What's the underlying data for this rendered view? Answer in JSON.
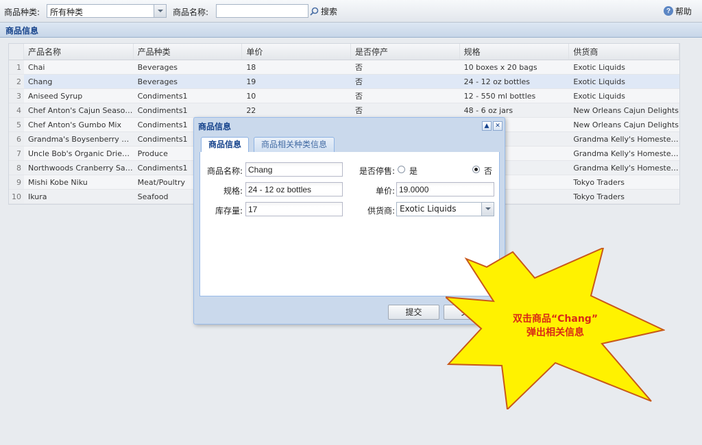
{
  "toolbar": {
    "category_label": "商品种类:",
    "category_value": "所有种类",
    "name_label": "商品名称:",
    "name_value": "",
    "search_label": "搜索",
    "help_label": "帮助"
  },
  "panel": {
    "title": "商品信息"
  },
  "grid": {
    "columns": [
      "产品名称",
      "产品种类",
      "单价",
      "是否停产",
      "规格",
      "供货商"
    ],
    "rows": [
      {
        "num": "1",
        "name": "Chai",
        "cat": "Beverages",
        "price": "18",
        "disc": "否",
        "spec": "10 boxes x 20 bags",
        "sup": "Exotic Liquids"
      },
      {
        "num": "2",
        "name": "Chang",
        "cat": "Beverages",
        "price": "19",
        "disc": "否",
        "spec": "24 - 12 oz bottles",
        "sup": "Exotic Liquids"
      },
      {
        "num": "3",
        "name": "Aniseed Syrup",
        "cat": "Condiments1",
        "price": "10",
        "disc": "否",
        "spec": "12 - 550 ml bottles",
        "sup": "Exotic Liquids"
      },
      {
        "num": "4",
        "name": "Chef Anton's Cajun Seasoning",
        "cat": "Condiments1",
        "price": "22",
        "disc": "否",
        "spec": "48 - 6 oz jars",
        "sup": "New Orleans Cajun Delights"
      },
      {
        "num": "5",
        "name": "Chef Anton's Gumbo Mix",
        "cat": "Condiments1",
        "price": "",
        "disc": "",
        "spec": "",
        "sup": "New Orleans Cajun Delights"
      },
      {
        "num": "6",
        "name": "Grandma's Boysenberry Spr...",
        "cat": "Condiments1",
        "price": "",
        "disc": "",
        "spec": "s",
        "sup": "Grandma Kelly's Homestead"
      },
      {
        "num": "7",
        "name": "Uncle Bob's Organic Dried Pe...",
        "cat": "Produce",
        "price": "",
        "disc": "",
        "spec": "s.",
        "sup": "Grandma Kelly's Homestead"
      },
      {
        "num": "8",
        "name": "Northwoods Cranberry Sauce",
        "cat": "Condiments1",
        "price": "",
        "disc": "",
        "spec": "rs",
        "sup": "Grandma Kelly's Homestead"
      },
      {
        "num": "9",
        "name": "Mishi Kobe Niku",
        "cat": "Meat/Poultry",
        "price": "",
        "disc": "",
        "spec": "kgs.",
        "sup": "Tokyo Traders"
      },
      {
        "num": "10",
        "name": "Ikura",
        "cat": "Seafood",
        "price": "",
        "disc": "",
        "spec": "ars",
        "sup": "Tokyo Traders"
      }
    ],
    "selected_row": 1
  },
  "dialog": {
    "title": "商品信息",
    "tabs": [
      "商品信息",
      "商品相关种类信息"
    ],
    "fields": {
      "name_label": "商品名称:",
      "name_value": "Chang",
      "discontinued_label": "是否停售:",
      "yes_label": "是",
      "no_label": "否",
      "discontinued_value": "否",
      "spec_label": "规格:",
      "spec_value": "24 - 12 oz bottles",
      "price_label": "单价:",
      "price_value": "19.0000",
      "stock_label": "库存量:",
      "stock_value": "17",
      "supplier_label": "供货商:",
      "supplier_value": "Exotic Liquids"
    },
    "submit_label": "提交",
    "close_label": "关闭"
  },
  "callout": {
    "line1": "双击商品“Chang”",
    "line2": "弹出相关信息",
    "fill_color": "#fff200",
    "stroke_color": "#c8581a",
    "text_color": "#d92a16"
  }
}
